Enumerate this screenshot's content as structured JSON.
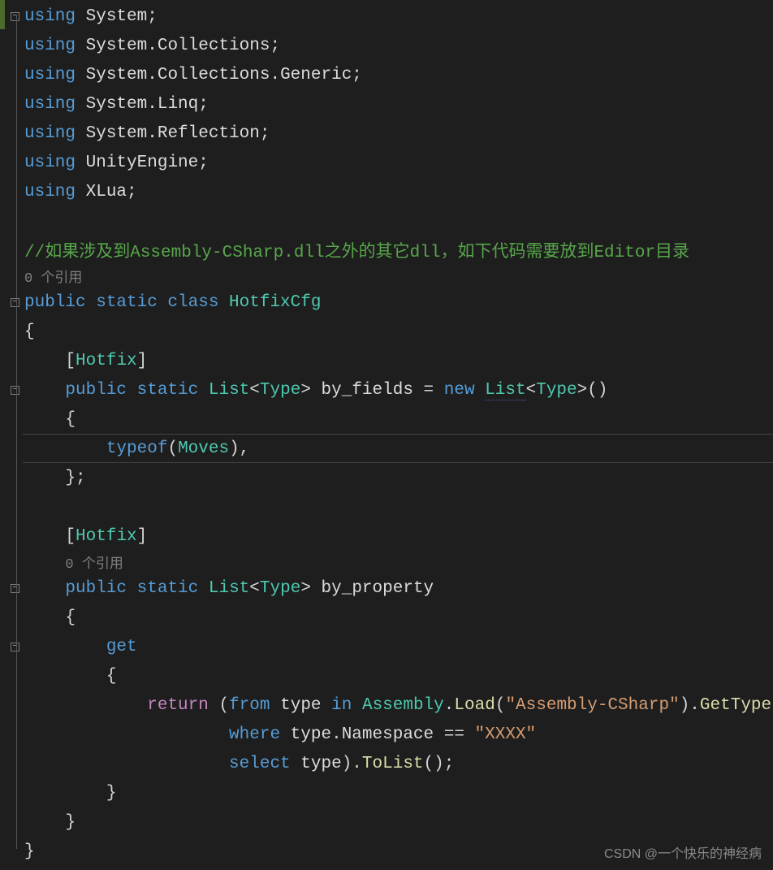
{
  "usings": [
    {
      "kw": "using",
      "ns": "System",
      "cls": ""
    },
    {
      "kw": "using",
      "ns": "System.",
      "cls": "Collections"
    },
    {
      "kw": "using",
      "ns": "System.Collections.",
      "cls": "Generic"
    },
    {
      "kw": "using",
      "ns": "System.",
      "cls": "Linq"
    },
    {
      "kw": "using",
      "ns": "System.",
      "cls": "Reflection"
    },
    {
      "kw": "using",
      "ns": "",
      "cls": "UnityEngine"
    },
    {
      "kw": "using",
      "ns": "",
      "cls": "XLua"
    }
  ],
  "comment": "//如果涉及到Assembly-CSharp.dll之外的其它dll，如下代码需要放到Editor目录",
  "lens1": "0 个引用",
  "lens2": "0 个引用",
  "classDecl": {
    "mods": "public static class ",
    "name": "HotfixCfg"
  },
  "attr": {
    "open": "[",
    "name": "Hotfix",
    "close": "]"
  },
  "field1": {
    "mods": "public static ",
    "listType": "List",
    "gen": "Type",
    "name": " by_fields",
    "assign": " = ",
    "newKw": "new ",
    "ctor": "List",
    "tail": "()"
  },
  "typeofLine": {
    "kw": "typeof",
    "arg": "Moves"
  },
  "prop": {
    "mods": "public static ",
    "listType": "List",
    "gen": "Type",
    "name": " by_property"
  },
  "getKw": "get",
  "linq": {
    "ret": "return",
    "from": "from",
    "typeVar": "type",
    "inKw": "in",
    "assembly": "Assembly",
    "load": "Load",
    "loadArg": "\"Assembly-CSharp\"",
    "getTypes": "GetTypes",
    "where": "where",
    "nsMember": "Namespace",
    "eq": " == ",
    "nsVal": "\"XXXX\"",
    "select": "select",
    "toList": "ToList"
  },
  "watermark": "CSDN @一个快乐的神经病"
}
